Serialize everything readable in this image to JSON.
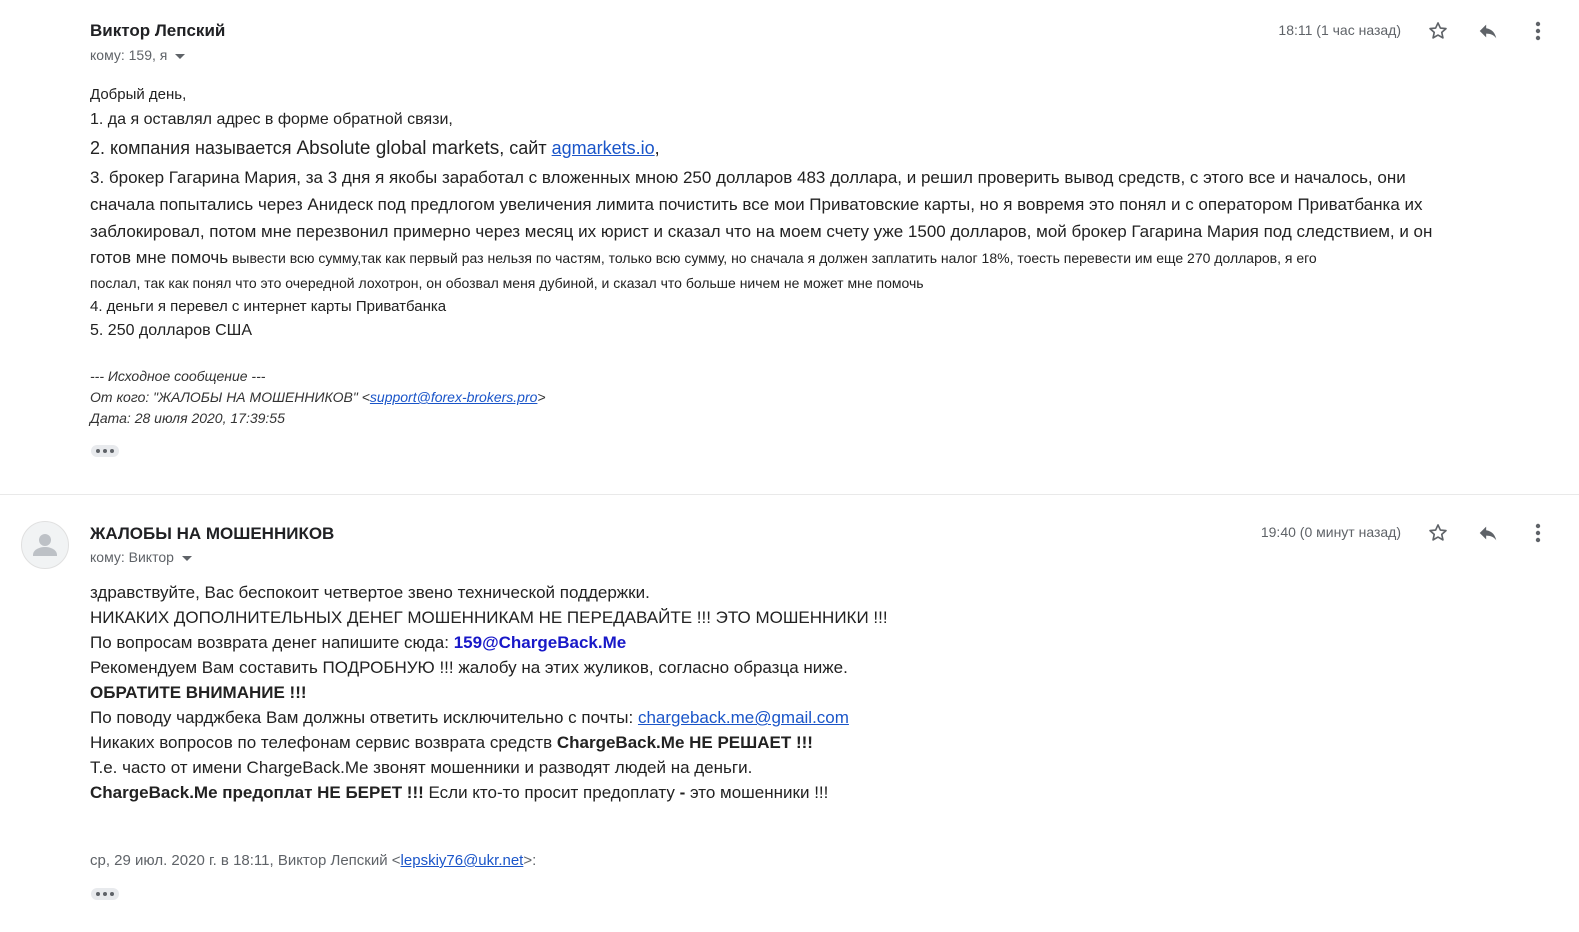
{
  "message1": {
    "sender": "Виктор Лепский",
    "to": "кому: 159, я",
    "time": "18:11 (1 час назад)",
    "body": {
      "line0": "Добрый день,",
      "line1": "1. да я оставлял адрес в форме обратной связи,",
      "line2_prefix": "2. компания называется ",
      "line2_company": "Absolute global markets",
      "line2_mid": ", сайт ",
      "line2_link": "agmarkets.io",
      "line2_suffix": ",",
      "line3": "3. брокер Гагарина Мария, за  3 дня я якобы заработал с вложенных мною 250 долларов 483 доллара, и решил проверить вывод средств, с этого все и началось, они",
      "line4": "сначала попытались через Анидеск под предлогом увеличения лимита почистить все мои Приватовские карты, но я вовремя это понял и с оператором Приватбанка их",
      "line5": "заблокировал, потом мне перезвонил примерно через месяц их юрист и сказал что на моем счету уже 1500 долларов, мой брокер Гагарина Мария под следствием, и он",
      "line6_a": "готов мне помочь",
      "line6_b": " вывести всю сумму,так как первый раз нельзя по частям, только всю сумму, но сначала я должен заплатить налог 18%, тоесть перевести им еще 270 долларов, я его",
      "line7": "послал, так как понял что это очередной лохотрон, он обозвал меня дубиной, и сказал что больше ничем не может мне помочь",
      "line8": "4. деньги я перевел с интернет карты Приватбанка",
      "line9": "5. 250 долларов США"
    },
    "quote": {
      "header": "--- Исходное сообщение ---",
      "from_prefix": "От кого: \"ЖАЛОБЫ НА МОШЕННИКОВ\" <",
      "from_email": "support@forex-brokers.pro",
      "from_suffix": ">",
      "date": "Дата: 28 июля 2020, 17:39:55"
    }
  },
  "message2": {
    "sender": "ЖАЛОБЫ НА МОШЕННИКОВ",
    "to": "кому: Виктор",
    "time": "19:40 (0 минут назад)",
    "body": {
      "line0": "здравствуйте, Вас беспокоит четвертое звено технической поддержки.",
      "line1": "НИКАКИХ ДОПОЛНИТЕЛЬНЫХ ДЕНЕГ МОШЕННИКАМ НЕ ПЕРЕДАВАЙТЕ !!! ЭТО МОШЕННИКИ !!!",
      "line2_prefix": "По вопросам возврата денег напишите сюда: ",
      "line2_email": "159@ChargeBack.Me",
      "line3": "Рекомендуем Вам составить ПОДРОБНУЮ !!! жалобу на этих жуликов, согласно образца ниже.",
      "line4": "ОБРАТИТЕ ВНИМАНИЕ !!!",
      "line5_prefix": "По поводу чарджбека Вам должны ответить исключительно с почты: ",
      "line5_email": "chargeback.me@gmail.com",
      "line6_prefix": "Никаких вопросов по телефонам сервис возврата средств ",
      "line6_bold": "ChargeBack.Me НЕ РЕШАЕТ !!!",
      "line7": "Т.е. часто от имени ChargeBack.Me звонят мошенники и разводят людей на деньги.",
      "line8_bold": "ChargeBack.Me предоплат НЕ БЕРЕТ !!!",
      "line8_mid": " Если кто-то просит предоплату ",
      "line8_dash": "-",
      "line8_end": " это мошенники !!!"
    },
    "quote": {
      "prefix": "ср, 29 июл. 2020 г. в 18:11, Виктор Лепский <",
      "email": "lepskiy76@ukr.net",
      "suffix": ">:"
    }
  },
  "icons": [
    "star-icon",
    "reply-icon",
    "more-vert-icon",
    "avatar-person-icon",
    "show-trimmed-content-icon"
  ],
  "colors": {
    "link": "#1a55c9",
    "highlight_email": "#1818c8",
    "icon": "#5f6368"
  }
}
